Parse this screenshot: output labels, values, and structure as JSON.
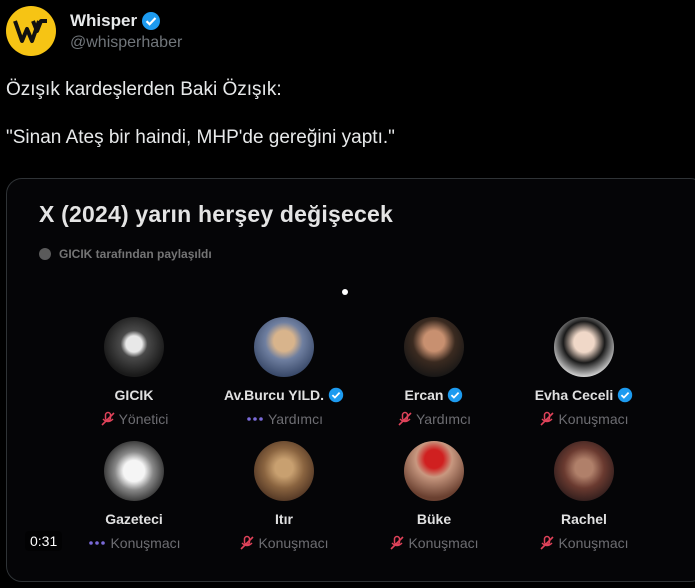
{
  "account": {
    "name": "Whisper",
    "handle": "@whisperhaber",
    "brand_color": "#f6c414",
    "verified_color": "#1d9bf0"
  },
  "tweet": {
    "line1": "Özışık kardeşlerden Baki Özışık:",
    "line2": "\"Sinan Ateş bir haindi, MHP'de gereğini yaptı.\""
  },
  "video": {
    "title": "X (2024) yarın herşey değişecek",
    "shared_by": "GICIK tarafından paylaşıldı",
    "timestamp": "0:31",
    "speakers": [
      {
        "name": "GICIK",
        "role": "Yönetici",
        "role_icon": "muted-mic-icon",
        "verified": false
      },
      {
        "name": "Av.Burcu YILD.",
        "role": "Yardımcı",
        "role_icon": "dots-icon",
        "verified": true
      },
      {
        "name": "Ercan",
        "role": "Yardımcı",
        "role_icon": "muted-mic-icon",
        "verified": true
      },
      {
        "name": "Evha Ceceli",
        "role": "Konuşmacı",
        "role_icon": "muted-mic-icon",
        "verified": true
      },
      {
        "name": "Gazeteci",
        "role": "Konuşmacı",
        "role_icon": "dots-icon",
        "verified": false
      },
      {
        "name": "Itır",
        "role": "Konuşmacı",
        "role_icon": "muted-mic-icon",
        "verified": false
      },
      {
        "name": "Büke",
        "role": "Konuşmacı",
        "role_icon": "muted-mic-icon",
        "verified": false
      },
      {
        "name": "Rachel",
        "role": "Konuşmacı",
        "role_icon": "muted-mic-icon",
        "verified": false
      }
    ]
  }
}
